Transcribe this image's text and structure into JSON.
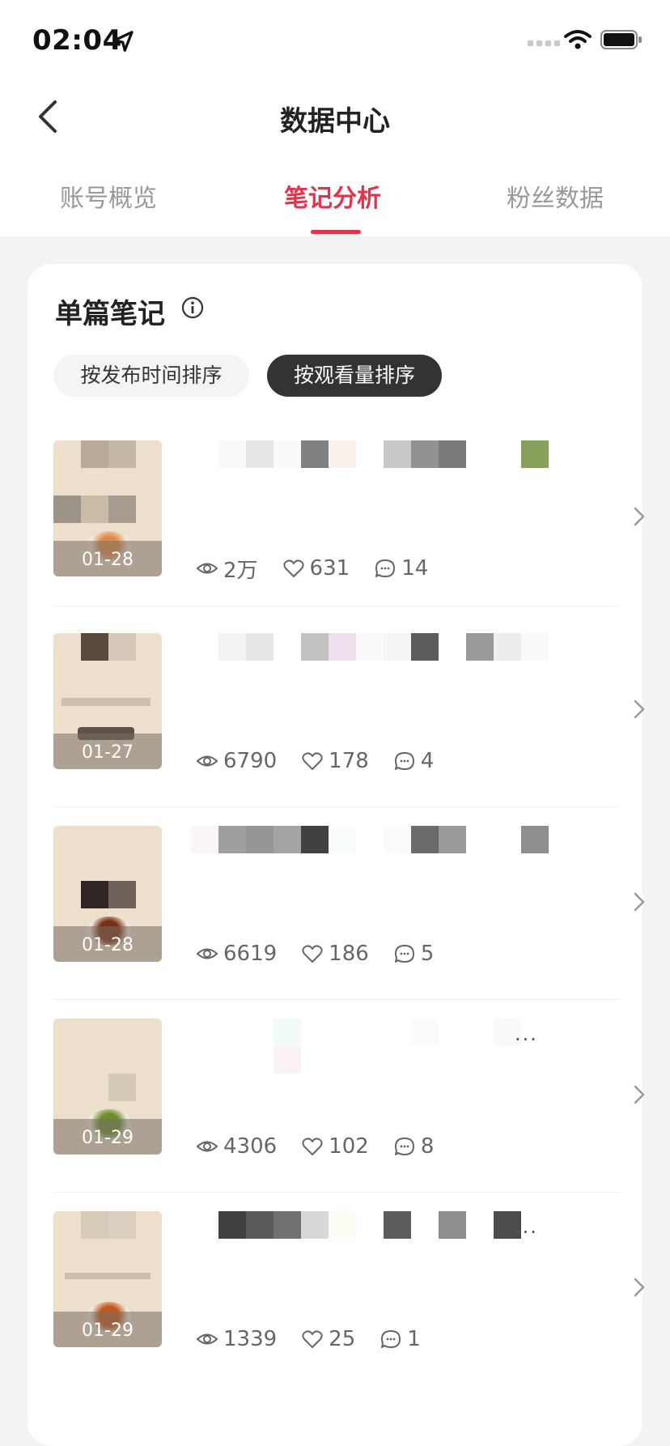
{
  "status_bar": {
    "time": "02:04"
  },
  "nav": {
    "title": "数据中心"
  },
  "tabs": [
    {
      "label": "账号概览",
      "active": false
    },
    {
      "label": "笔记分析",
      "active": true
    },
    {
      "label": "粉丝数据",
      "active": false
    }
  ],
  "section": {
    "title": "单篇笔记",
    "sort_by_time": "按发布时间排序",
    "sort_by_views": "按观看量排序",
    "selected_sort": "按观看量排序"
  },
  "notes": [
    {
      "date": "01-28",
      "views": "2万",
      "likes": "631",
      "comments": "14"
    },
    {
      "date": "01-27",
      "views": "6790",
      "likes": "178",
      "comments": "4"
    },
    {
      "date": "01-28",
      "views": "6619",
      "likes": "186",
      "comments": "5"
    },
    {
      "date": "01-29",
      "views": "4306",
      "likes": "102",
      "comments": "8"
    },
    {
      "date": "01-29",
      "views": "1339",
      "likes": "25",
      "comments": "1"
    }
  ],
  "colors": {
    "accent": "#e5324b",
    "chip_selected": "#333333"
  }
}
